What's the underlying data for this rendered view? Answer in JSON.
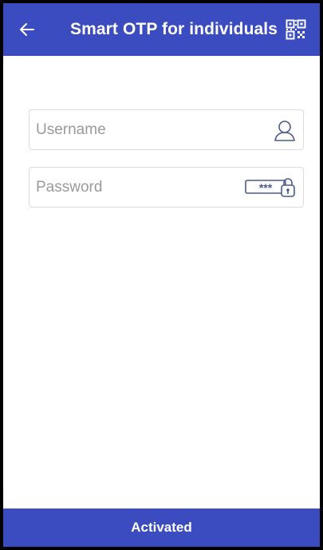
{
  "header": {
    "title": "Smart OTP for individuals",
    "back_icon": "arrow-left-icon",
    "qr_icon": "qr-code-icon"
  },
  "form": {
    "username": {
      "placeholder": "Username",
      "value": "",
      "icon": "user-icon"
    },
    "password": {
      "placeholder": "Password",
      "value": "",
      "icon": "password-lock-icon",
      "icon_text": "***"
    }
  },
  "footer": {
    "label": "Activated"
  },
  "colors": {
    "primary": "#3b4bc0",
    "icon_stroke": "#4a5a88",
    "border": "#dcdcdc",
    "placeholder": "#9a9a9a"
  }
}
